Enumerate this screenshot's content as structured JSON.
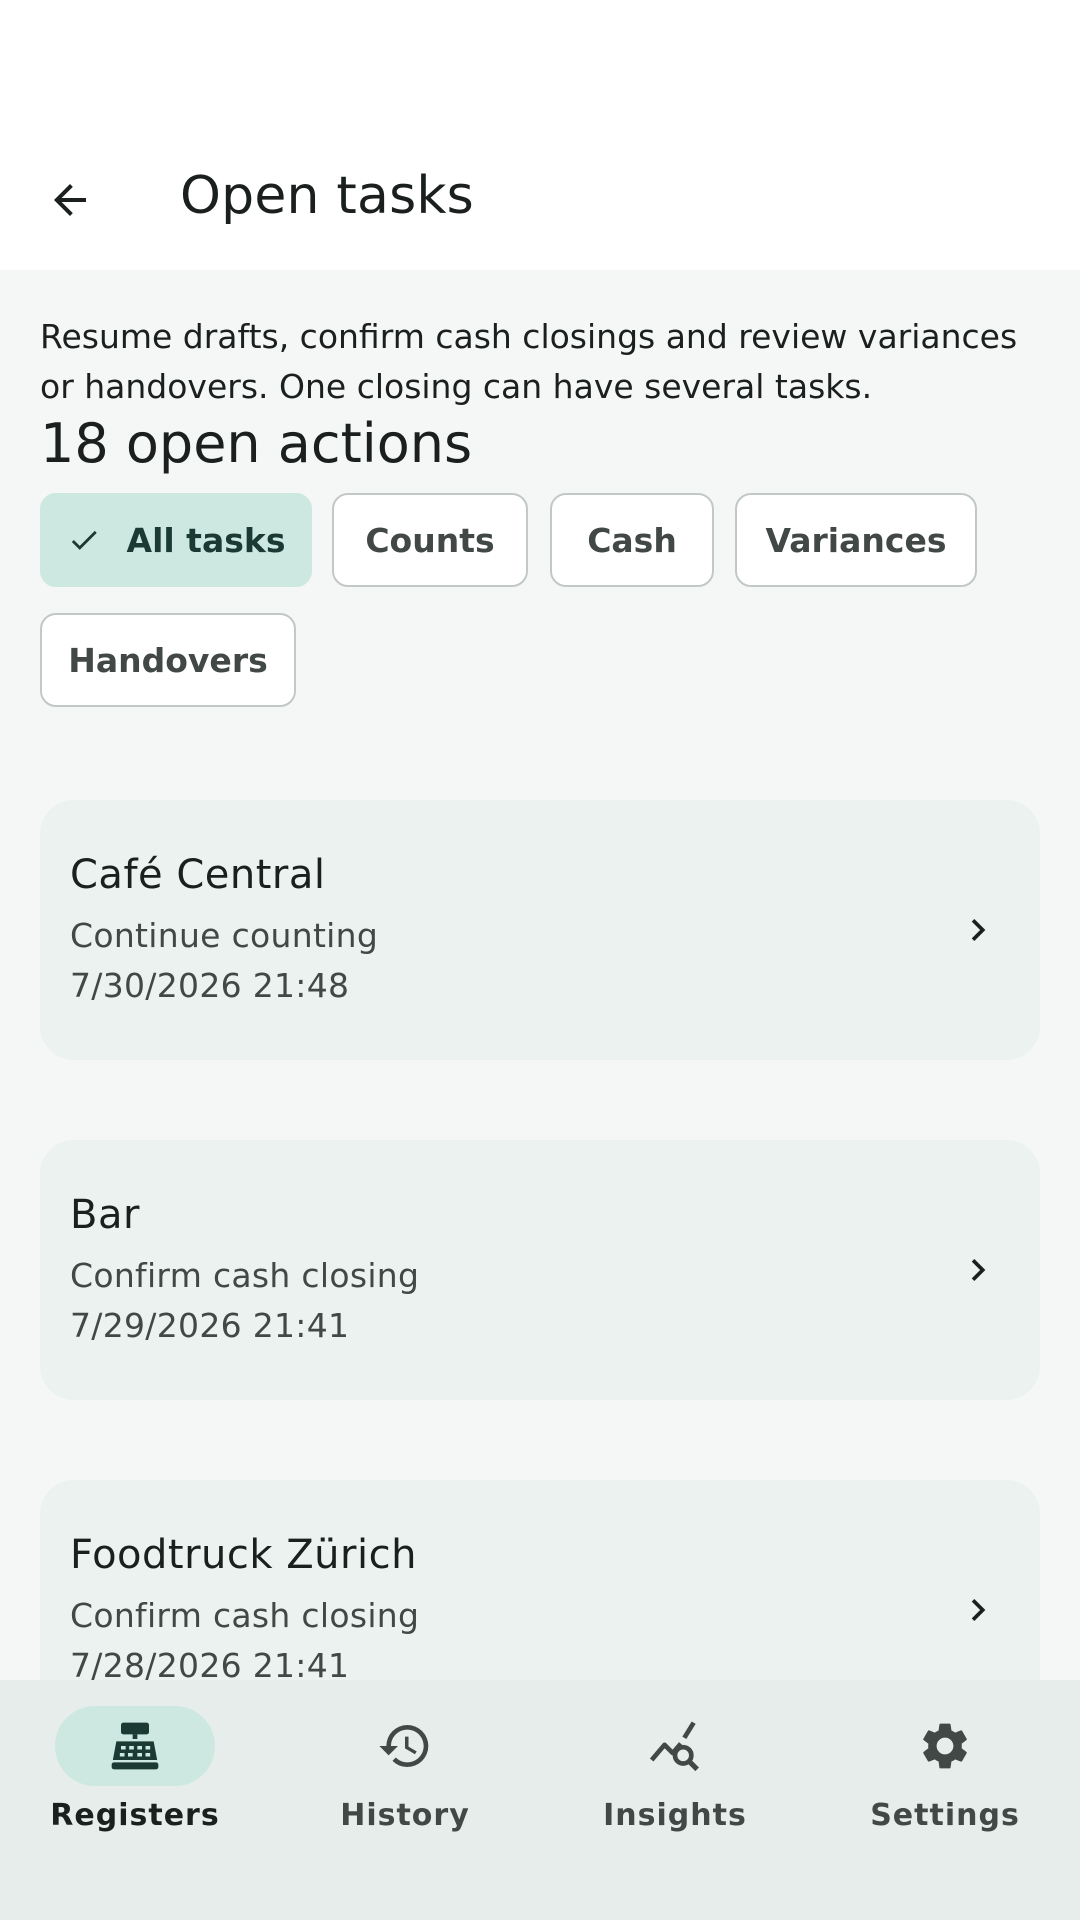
{
  "header": {
    "title": "Open tasks",
    "back_icon": "arrow-back-icon"
  },
  "description": "Resume drafts, confirm cash closings and review variances or handovers. One closing can have several tasks.",
  "count_heading": "18 open actions",
  "filters": [
    {
      "label": "All tasks",
      "selected": true
    },
    {
      "label": "Counts",
      "selected": false
    },
    {
      "label": "Cash",
      "selected": false
    },
    {
      "label": "Variances",
      "selected": false
    },
    {
      "label": "Handovers",
      "selected": false
    }
  ],
  "tasks": [
    {
      "name": "Café Central",
      "task": "Continue counting",
      "time": "7/30/2026 21:48"
    },
    {
      "name": "Bar",
      "task": "Confirm cash closing",
      "time": "7/29/2026 21:41"
    },
    {
      "name": "Foodtruck Zürich",
      "task": "Confirm cash closing",
      "time": "7/28/2026 21:41"
    }
  ],
  "nav": [
    {
      "label": "Registers",
      "icon": "cash-register-icon",
      "active": true
    },
    {
      "label": "History",
      "icon": "history-icon",
      "active": false
    },
    {
      "label": "Insights",
      "icon": "insights-icon",
      "active": false
    },
    {
      "label": "Settings",
      "icon": "gear-icon",
      "active": false
    }
  ],
  "colors": {
    "accent_container": "#cde8e1",
    "card_background": "#ebf2f0",
    "nav_background": "#e6edeb",
    "page_background": "#f4f7f6"
  }
}
